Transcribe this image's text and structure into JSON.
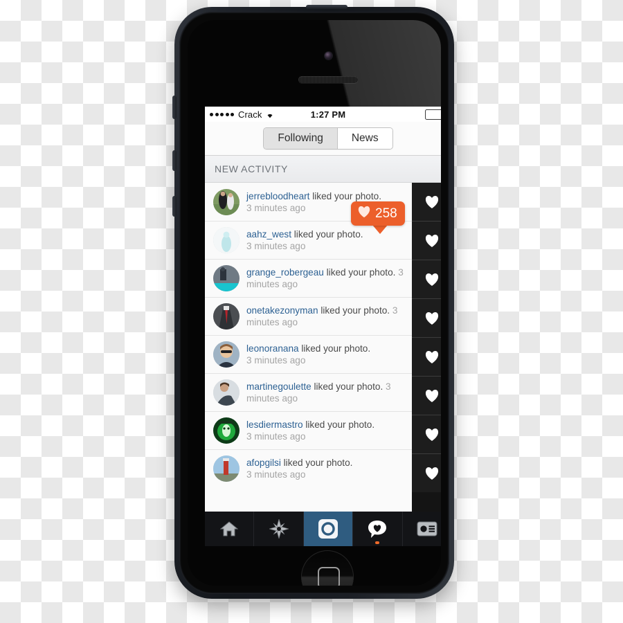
{
  "device": {
    "name": "iphone-5-black",
    "home_button": "home-button"
  },
  "status_bar": {
    "signal_dots": 5,
    "carrier": "Crack",
    "wifi_icon": "wifi-icon",
    "time": "1:27 PM",
    "battery_icon": "battery-full-icon"
  },
  "segmented_control": {
    "options": [
      {
        "label": "Following",
        "selected": true
      },
      {
        "label": "News",
        "selected": false
      }
    ]
  },
  "section": {
    "header": "NEW ACTIVITY"
  },
  "activity": {
    "action_text": "liked your photo.",
    "rows": [
      {
        "username": "jerrebloodheart",
        "action": "liked your photo.",
        "time": "3 minutes ago",
        "avatar": "avatar-couple-lawn",
        "heart_icon": "heart-icon"
      },
      {
        "username": "aahz_west",
        "action": "liked your photo.",
        "time": "3 minutes ago",
        "avatar": "avatar-pale-figure",
        "heart_icon": "heart-icon"
      },
      {
        "username": "grange_robergeau",
        "action": "liked your photo.",
        "time": "3 minutes ago",
        "avatar": "avatar-skater-teal",
        "heart_icon": "heart-icon"
      },
      {
        "username": "onetakezonyman",
        "action": "liked your photo.",
        "time": "3 minutes ago",
        "avatar": "avatar-suit-red-tie",
        "heart_icon": "heart-icon"
      },
      {
        "username": "leonoranana",
        "action": "liked your photo.",
        "time": "3 minutes ago",
        "avatar": "avatar-sunglasses",
        "heart_icon": "heart-icon"
      },
      {
        "username": "martinegoulette",
        "action": "liked your photo.",
        "time": "3 minutes ago",
        "avatar": "avatar-seated-person",
        "heart_icon": "heart-icon"
      },
      {
        "username": "lesdiermastro",
        "action": "liked your photo.",
        "time": "3 minutes ago",
        "avatar": "avatar-green-mask",
        "heart_icon": "heart-icon"
      },
      {
        "username": "afopgilsi",
        "action": "liked your photo.",
        "time": "3 minutes ago",
        "avatar": "avatar-lighthouse",
        "heart_icon": "heart-icon"
      }
    ]
  },
  "like_badge": {
    "count": "258",
    "icon": "heart-icon",
    "color": "#ec5f2b"
  },
  "tab_bar": {
    "tabs": [
      {
        "name": "tab-home",
        "icon": "home-icon",
        "active": false,
        "dot": false
      },
      {
        "name": "tab-explore",
        "icon": "compass-star-icon",
        "active": false,
        "dot": false
      },
      {
        "name": "tab-camera",
        "icon": "camera-icon",
        "active": true,
        "dot": false
      },
      {
        "name": "tab-activity",
        "icon": "heart-bubble-icon",
        "active": false,
        "dot": true
      },
      {
        "name": "tab-profile",
        "icon": "id-card-icon",
        "active": false,
        "dot": false
      }
    ]
  },
  "colors": {
    "link": "#2d6193",
    "accent_orange": "#ec5f2b",
    "tab_active_blue": "#2f5c80",
    "list_bg": "#fafafa",
    "heart_column": "#1d1d1d"
  }
}
